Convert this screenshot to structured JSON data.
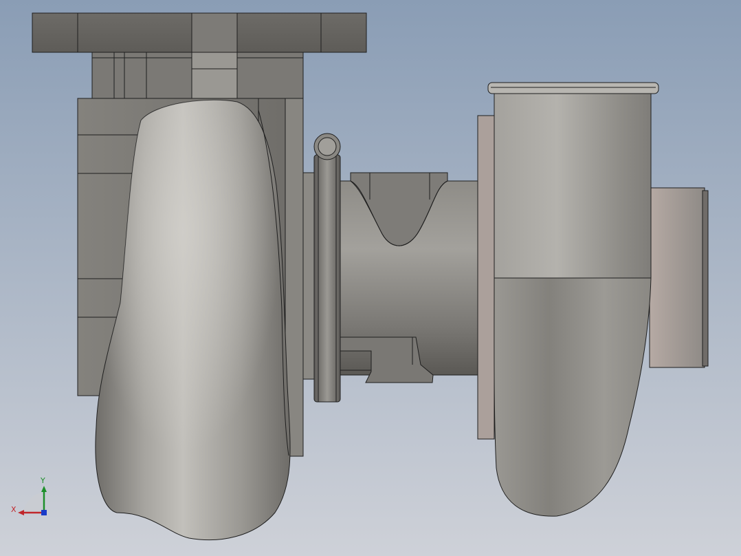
{
  "viewport": {
    "background_top": "#8a9db5",
    "background_bottom": "#ced1d8"
  },
  "model": {
    "body_color": "#8e8c87",
    "edge_color": "#1e1e1e"
  },
  "triad": {
    "x_label": "X",
    "y_label": "Y",
    "x_color": "#c0262b",
    "y_color": "#1d8f2a",
    "z_color": "#1a3cc8"
  }
}
